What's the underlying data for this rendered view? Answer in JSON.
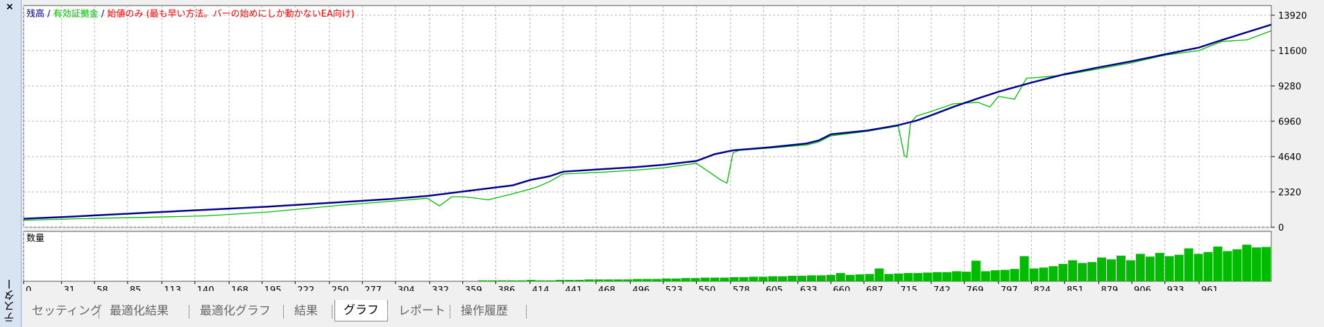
{
  "window": {
    "side_title": "テスター",
    "close_label": "×"
  },
  "legend": {
    "balance": "残高",
    "separator": " / ",
    "equity": "有効証拠金",
    "method": "始値のみ (最も早い方法。バーの始めにしか動かないEA向け)"
  },
  "colors": {
    "balance": "#00008b",
    "equity": "#00bb00",
    "method": "#ff0000",
    "volume": "#00bb00",
    "grid": "#b4b4b4"
  },
  "volume_label": "数量",
  "tabs": [
    {
      "label": "セッティング",
      "active": false
    },
    {
      "label": "最適化結果",
      "active": false
    },
    {
      "label": "最適化グラフ",
      "active": false
    },
    {
      "label": "結果",
      "active": false
    },
    {
      "label": "グラフ",
      "active": true
    },
    {
      "label": "レポート",
      "active": false
    },
    {
      "label": "操作履歴",
      "active": false
    }
  ],
  "chart_data": {
    "type": "line",
    "x_ticks": [
      0,
      31,
      58,
      85,
      113,
      140,
      168,
      195,
      222,
      250,
      277,
      304,
      332,
      359,
      386,
      414,
      441,
      468,
      496,
      523,
      550,
      578,
      605,
      633,
      660,
      687,
      715,
      742,
      769,
      797,
      824,
      851,
      879,
      906,
      933,
      961
    ],
    "y_ticks": [
      0,
      2320,
      4640,
      6960,
      9280,
      11600,
      13920
    ],
    "xlim": [
      0,
      1020
    ],
    "ylim": [
      0,
      13920
    ],
    "grid": true,
    "series": [
      {
        "name": "残高",
        "x": [
          0,
          40,
          100,
          150,
          200,
          260,
          300,
          330,
          360,
          380,
          400,
          414,
          430,
          441,
          470,
          500,
          523,
          550,
          565,
          580,
          610,
          640,
          650,
          660,
          690,
          715,
          730,
          742,
          760,
          780,
          797,
          824,
          851,
          879,
          906,
          933,
          961,
          980,
          1000,
          1020
        ],
        "y": [
          560,
          700,
          950,
          1150,
          1350,
          1650,
          1850,
          2050,
          2350,
          2550,
          2750,
          3100,
          3350,
          3650,
          3800,
          3950,
          4100,
          4350,
          4800,
          5050,
          5250,
          5500,
          5700,
          6100,
          6350,
          6700,
          7000,
          7350,
          7900,
          8450,
          8900,
          9500,
          10050,
          10500,
          10900,
          11350,
          11800,
          12300,
          12800,
          13300
        ]
      },
      {
        "name": "有効証拠金",
        "x": [
          0,
          40,
          100,
          150,
          200,
          260,
          300,
          330,
          340,
          350,
          360,
          380,
          400,
          414,
          420,
          430,
          441,
          470,
          500,
          523,
          550,
          570,
          575,
          580,
          585,
          610,
          640,
          650,
          660,
          690,
          715,
          720,
          722,
          725,
          730,
          742,
          760,
          780,
          790,
          797,
          810,
          820,
          824,
          851,
          879,
          906,
          933,
          961,
          970,
          980,
          1000,
          1020
        ],
        "y": [
          450,
          550,
          650,
          750,
          1000,
          1450,
          1700,
          1900,
          1400,
          2000,
          2000,
          1800,
          2200,
          2500,
          2650,
          3000,
          3500,
          3600,
          3750,
          3900,
          4200,
          3100,
          2900,
          4900,
          5050,
          5200,
          5400,
          5600,
          6000,
          6300,
          6650,
          4700,
          4600,
          6850,
          7300,
          7600,
          8100,
          8200,
          7900,
          8600,
          8400,
          9800,
          9800,
          10000,
          10400,
          10800,
          11300,
          11600,
          11900,
          12200,
          12300,
          12900
        ]
      }
    ],
    "volume": {
      "label": "数量",
      "max": 1.0,
      "values": [
        0,
        0,
        0,
        0,
        0,
        0,
        0,
        0,
        0,
        0,
        0,
        0,
        0,
        0,
        0,
        0,
        0,
        0,
        0,
        0,
        0,
        0,
        0,
        0,
        0,
        0,
        0,
        0,
        0,
        0,
        0,
        0,
        0,
        0,
        0,
        0,
        0,
        0,
        0,
        0,
        0,
        0,
        0,
        0,
        0,
        0,
        0,
        0.02,
        0.02,
        0.02,
        0.02,
        0.02,
        0.03,
        0.02,
        0.02,
        0.03,
        0.03,
        0.03,
        0.04,
        0.04,
        0.04,
        0.04,
        0.04,
        0.05,
        0.05,
        0.05,
        0.06,
        0.06,
        0.07,
        0.07,
        0.08,
        0.08,
        0.08,
        0.09,
        0.09,
        0.1,
        0.1,
        0.11,
        0.11,
        0.12,
        0.12,
        0.13,
        0.13,
        0.14,
        0.18,
        0.14,
        0.15,
        0.16,
        0.28,
        0.16,
        0.17,
        0.18,
        0.18,
        0.19,
        0.2,
        0.2,
        0.22,
        0.21,
        0.45,
        0.22,
        0.24,
        0.25,
        0.27,
        0.55,
        0.28,
        0.3,
        0.33,
        0.38,
        0.46,
        0.4,
        0.42,
        0.52,
        0.48,
        0.56,
        0.46,
        0.6,
        0.54,
        0.62,
        0.55,
        0.58,
        0.72,
        0.6,
        0.64,
        0.76,
        0.66,
        0.7,
        0.8,
        0.74,
        0.75
      ]
    }
  }
}
